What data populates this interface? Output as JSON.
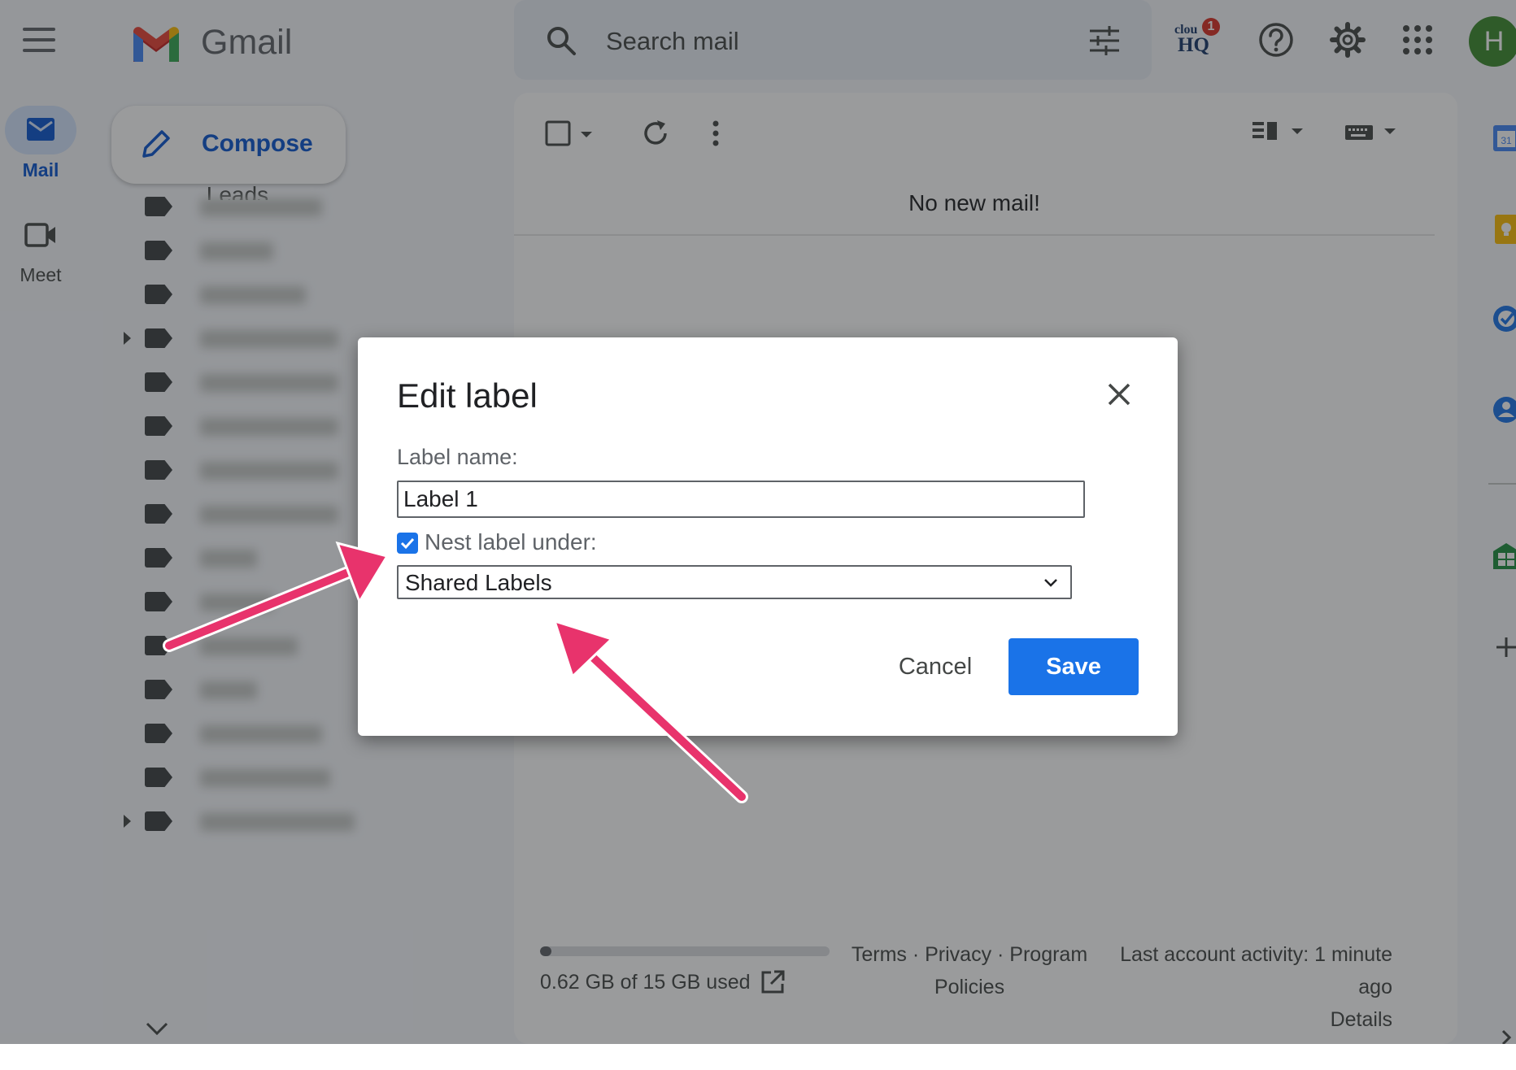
{
  "app": {
    "name": "Gmail",
    "search_placeholder": "Search mail",
    "avatar_initial": "H",
    "cloudhq_line1": "clou",
    "cloudhq_line2": "HQ",
    "cloudhq_badge": "1"
  },
  "rail": {
    "mail_label": "Mail",
    "meet_label": "Meet"
  },
  "compose_label": "Compose",
  "sidebar": {
    "top_partial_label": ".Leads",
    "rows": [
      {
        "has_arrow": false
      },
      {
        "has_arrow": false
      },
      {
        "has_arrow": false
      },
      {
        "has_arrow": true
      },
      {
        "has_arrow": false
      },
      {
        "has_arrow": false
      },
      {
        "has_arrow": false
      },
      {
        "has_arrow": false
      },
      {
        "has_arrow": false
      },
      {
        "has_arrow": false
      },
      {
        "has_arrow": false
      },
      {
        "has_arrow": false
      },
      {
        "has_arrow": false
      },
      {
        "has_arrow": false
      },
      {
        "has_arrow": true
      }
    ]
  },
  "main": {
    "empty_message": "No new mail!",
    "storage_text": "0.62 GB of 15 GB used",
    "storage_fraction": 0.04,
    "footer_line1": "Terms · Privacy · Program",
    "footer_line2": "Policies",
    "activity_line1": "Last account activity: 1 minute",
    "activity_line2": "ago",
    "activity_line3": "Details"
  },
  "dialog": {
    "title": "Edit label",
    "name_label": "Label name:",
    "name_value": "Label 1",
    "nest_checked": true,
    "nest_label": "Nest label under:",
    "nest_selected": "Shared Labels",
    "cancel_label": "Cancel",
    "save_label": "Save"
  },
  "colors": {
    "accent": "#1a73e8",
    "arrow": "#e8336c",
    "avatar": "#3c8a2e"
  },
  "side_apps": [
    "calendar-icon",
    "keep-icon",
    "tasks-icon",
    "contacts-icon",
    "sheets-icon",
    "add-icon"
  ]
}
